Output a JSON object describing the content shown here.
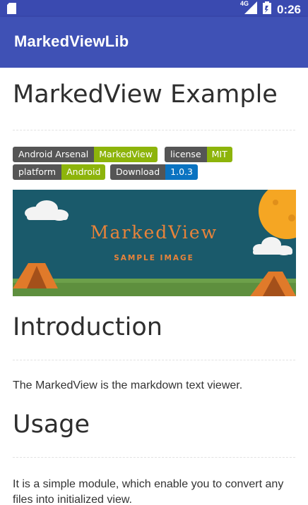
{
  "status_bar": {
    "network": "4G",
    "time": "0:26",
    "icons": [
      "sd-card-icon",
      "cell-signal-icon",
      "battery-icon"
    ]
  },
  "app_bar": {
    "title": "MarkedViewLib"
  },
  "content": {
    "title": "MarkedView Example",
    "badges": [
      {
        "left": "Android Arsenal",
        "right": "MarkedView",
        "color": "#8db40b"
      },
      {
        "left": "license",
        "right": "MIT",
        "color": "#8db40b"
      },
      {
        "left": "platform",
        "right": "Android",
        "color": "#8db40b"
      },
      {
        "left": "Download",
        "right": "1.0.3",
        "color": "#0a73c1"
      }
    ],
    "banner": {
      "title": "MarkedView",
      "subtitle": "SAMPLE IMAGE"
    },
    "sections": [
      {
        "heading": "Introduction",
        "text": "The MarkedView is the markdown text viewer."
      },
      {
        "heading": "Usage",
        "text": "It is a simple module, which enable you to convert any files into initialized view."
      }
    ]
  },
  "colors": {
    "primary": "#3f51b5",
    "status_bar": "#3a4ab0",
    "badge_label": "#555555",
    "badge_green": "#8db40b",
    "badge_blue": "#0a73c1",
    "banner_bg": "#1a5a6b",
    "banner_text": "#e8833a"
  }
}
